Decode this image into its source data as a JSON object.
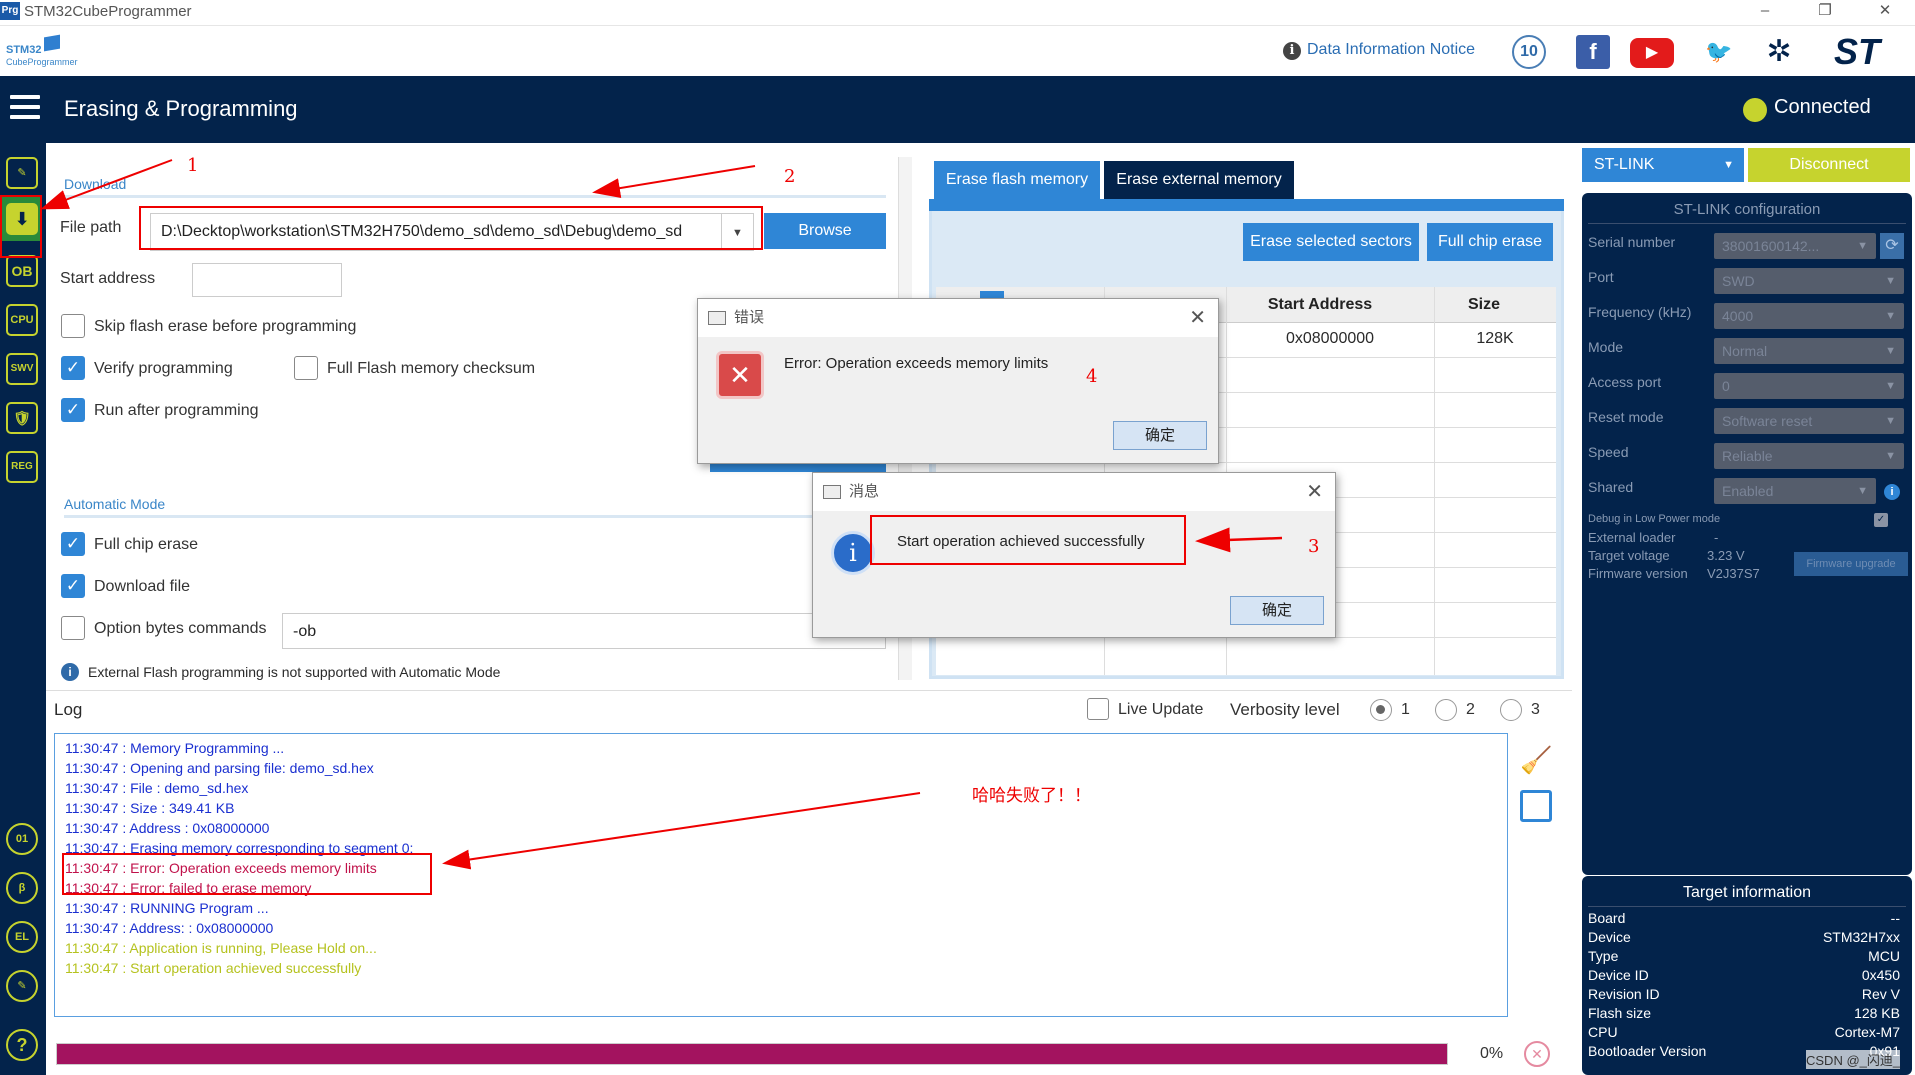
{
  "window": {
    "app_icon_text": "Prg",
    "title": "STM32CubeProgrammer",
    "minimize": "–",
    "maximize": "❐",
    "close": "✕"
  },
  "header": {
    "logo_top": "STM32",
    "logo_bottom": "CubeProgrammer",
    "notice_icon": "i",
    "notice": "Data Information Notice",
    "anniversary": "10",
    "facebook": "f",
    "youtube": "▶",
    "twitter": "🐦",
    "network": "✲",
    "st_logo": "ST"
  },
  "navbar": {
    "page_title": "Erasing & Programming",
    "status": "Connected",
    "status_color": "#c6d32e"
  },
  "sidebar": {
    "items": [
      "✎",
      "⬇",
      "OB",
      "CPU",
      "SWV",
      "🛡",
      "REG",
      "01",
      "β",
      "EL",
      "✎",
      "?"
    ]
  },
  "download": {
    "section": "Download",
    "file_path_label": "File path",
    "file_path_value": "D:\\Decktop\\workstation\\STM32H750\\demo_sd\\demo_sd\\Debug\\demo_sd",
    "dropdown_arrow": "▼",
    "browse": "Browse",
    "start_address_label": "Start address",
    "start_address_value": "",
    "skip_erase": "Skip flash erase before programming",
    "verify": "Verify programming",
    "full_checksum": "Full Flash memory checksum",
    "run_after": "Run after programming",
    "check": "✓"
  },
  "automatic": {
    "section": "Automatic Mode",
    "full_chip_erase": "Full chip erase",
    "download_file": "Download file",
    "option_bytes": "Option bytes commands",
    "option_bytes_value": "-ob",
    "info_icon": "i",
    "note": "External Flash programming is not supported with Automatic Mode"
  },
  "erase": {
    "tabs": [
      "Erase flash memory",
      "Erase external memory"
    ],
    "erase_selected": "Erase selected sectors",
    "full_chip": "Full chip erase",
    "columns": [
      "Start Address",
      "Size"
    ],
    "rows": [
      {
        "start": "0x08000000",
        "size": "128K"
      }
    ]
  },
  "stlink": {
    "interface": "ST-LINK",
    "disconnect": "Disconnect",
    "config_title": "ST-LINK configuration",
    "fields": [
      {
        "label": "Serial number",
        "value": "38001600142..."
      },
      {
        "label": "Port",
        "value": "SWD"
      },
      {
        "label": "Frequency (kHz)",
        "value": "4000"
      },
      {
        "label": "Mode",
        "value": "Normal"
      },
      {
        "label": "Access port",
        "value": "0"
      },
      {
        "label": "Reset mode",
        "value": "Software reset"
      },
      {
        "label": "Speed",
        "value": "Reliable"
      },
      {
        "label": "Shared",
        "value": "Enabled"
      }
    ],
    "low_power": "Debug in Low Power mode",
    "external_loader": "External loader",
    "external_loader_value": "-",
    "target_voltage": "Target voltage",
    "target_voltage_value": "3.23 V",
    "firmware_version": "Firmware version",
    "firmware_version_value": "V2J37S7",
    "firmware_upgrade": "Firmware upgrade",
    "refresh_icon": "⟳",
    "info_icon": "i"
  },
  "target": {
    "title": "Target information",
    "rows": [
      {
        "label": "Board",
        "value": "--"
      },
      {
        "label": "Device",
        "value": "STM32H7xx"
      },
      {
        "label": "Type",
        "value": "MCU"
      },
      {
        "label": "Device ID",
        "value": "0x450"
      },
      {
        "label": "Revision ID",
        "value": "Rev V"
      },
      {
        "label": "Flash size",
        "value": "128 KB"
      },
      {
        "label": "CPU",
        "value": "Cortex-M7"
      },
      {
        "label": "Bootloader Version",
        "value": "0x91"
      }
    ]
  },
  "log": {
    "title": "Log",
    "live_update": "Live Update",
    "verbosity": "Verbosity level",
    "levels": [
      "1",
      "2",
      "3"
    ],
    "lines": [
      {
        "text": "11:30:47 : Memory Programming ...",
        "color": "#1a2fd0"
      },
      {
        "text": "11:30:47 : Opening and parsing file: demo_sd.hex",
        "color": "#1a2fd0"
      },
      {
        "text": "11:30:47 :   File          : demo_sd.hex",
        "color": "#1a2fd0"
      },
      {
        "text": "11:30:47 :   Size          : 349.41 KB",
        "color": "#1a2fd0"
      },
      {
        "text": "11:30:47 :   Address       : 0x08000000",
        "color": "#1a2fd0"
      },
      {
        "text": "11:30:47 : Erasing memory corresponding to segment 0:",
        "color": "#1a2fd0"
      },
      {
        "text": "11:30:47 : Error: Operation exceeds memory limits",
        "color": "#c0114a"
      },
      {
        "text": "11:30:47 : Error: failed to erase memory",
        "color": "#c0114a"
      },
      {
        "text": "11:30:47 : RUNNING Program ...",
        "color": "#1a2fd0"
      },
      {
        "text": "11:30:47 :   Address:      : 0x08000000",
        "color": "#1a2fd0"
      },
      {
        "text": "11:30:47 : Application is running, Please Hold on...",
        "color": "#b5c21e"
      },
      {
        "text": "11:30:47 : Start operation achieved successfully",
        "color": "#b5c21e"
      }
    ],
    "clear_icon": "🧹",
    "save_icon": "💾"
  },
  "progress": {
    "percent_text": "0%",
    "value": 1.0,
    "color": "#a3135f",
    "cancel_icon": "✕"
  },
  "dialog_error": {
    "title": "错误",
    "message": "Error: Operation exceeds memory limits",
    "ok": "确定",
    "icon": "✕"
  },
  "dialog_info": {
    "title": "消息",
    "message": "Start operation achieved successfully",
    "ok": "确定",
    "icon": "i"
  },
  "annotations": {
    "n1": "1",
    "n2": "2",
    "n3": "3",
    "n4": "4",
    "comment": "哈哈失败了！！"
  },
  "watermark": "CSDN @_闪迪_"
}
